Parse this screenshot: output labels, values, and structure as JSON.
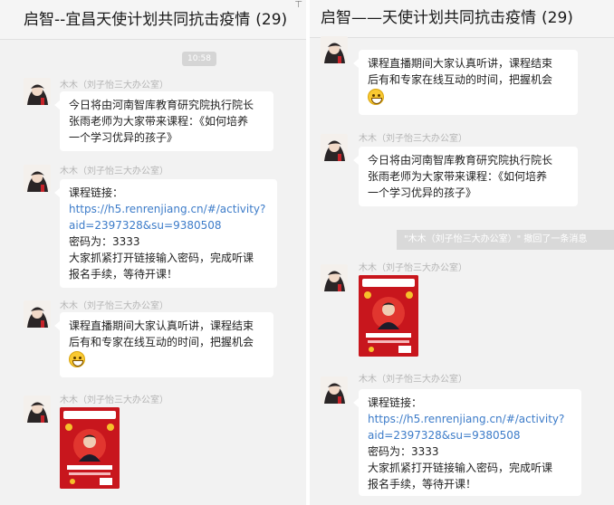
{
  "left_window": {
    "title": "启智--宜昌天使计划共同抗击疫情",
    "member_count": "(29)",
    "pin_icon": "pin-icon",
    "timestamp": "10:58",
    "messages": [
      {
        "sender": "木木（刘子怡三大办公室）",
        "lines": [
          "今日将由河南智库教育研究院执行院长",
          "张雨老师为大家带来课程：《如何培养",
          "一个学习优异的孩子》"
        ]
      },
      {
        "sender": "木木（刘子怡三大办公室）",
        "lines": [
          "课程链接：",
          "https://h5.renrenjiang.cn/#/activity?",
          "aid=2397328&su=9380508",
          "密码为：3333",
          "大家抓紧打开链接输入密码，完成听课",
          "报名手续，等待开课！"
        ]
      },
      {
        "sender": "木木（刘子怡三大办公室）",
        "lines": [
          "课程直播期间大家认真听讲，课程结束",
          "后有和专家在线互动的时间，把握机会"
        ],
        "emoji": "grin-emoji"
      },
      {
        "sender": "木木（刘子怡三大办公室）",
        "image": "course-poster"
      }
    ]
  },
  "right_window": {
    "title": "启智——天使计划共同抗击疫情",
    "member_count": "(29)",
    "recall_notice": "\"木木（刘子怡三大办公室）\" 撤回了一条消息",
    "messages": [
      {
        "lines": [
          "课程直播期间大家认真听讲，课程结束",
          "后有和专家在线互动的时间，把握机会"
        ],
        "emoji": "grin-emoji"
      },
      {
        "sender": "木木（刘子怡三大办公室）",
        "lines": [
          "今日将由河南智库教育研究院执行院长",
          "张雨老师为大家带来课程：《如何培养",
          "一个学习优异的孩子》"
        ]
      },
      {
        "sender": "木木（刘子怡三大办公室）",
        "image": "course-poster"
      },
      {
        "sender": "木木（刘子怡三大办公室）",
        "lines": [
          "课程链接：",
          "https://h5.renrenjiang.cn/#/activity?",
          "aid=2397328&su=9380508",
          "密码为：3333",
          "大家抓紧打开链接输入密码，完成听课",
          "报名手续，等待开课！"
        ]
      }
    ]
  },
  "colors": {
    "link": "#3d7cc9",
    "poster_red": "#c8161d",
    "chat_bg": "#f2f2f2"
  }
}
